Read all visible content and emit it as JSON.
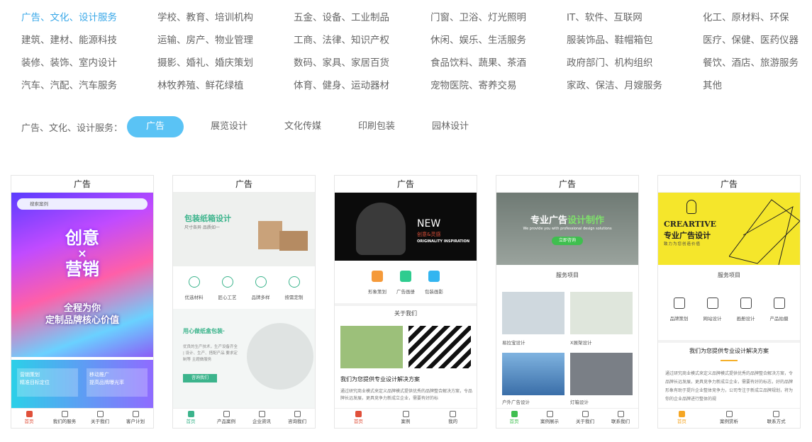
{
  "categories": [
    "广告、文化、设计服务",
    "学校、教育、培训机构",
    "五金、设备、工业制品",
    "门窗、卫浴、灯光照明",
    "IT、软件、互联网",
    "化工、原材料、环保",
    "建筑、建材、能源科技",
    "运输、房产、物业管理",
    "工商、法律、知识产权",
    "休闲、娱乐、生活服务",
    "服装饰品、鞋帽箱包",
    "医疗、保健、医药仪器",
    "装修、装饰、室内设计",
    "摄影、婚礼、婚庆策划",
    "数码、家具、家居百货",
    "食品饮料、蔬果、茶酒",
    "政府部门、机构组织",
    "餐饮、酒店、旅游服务",
    "汽车、汽配、汽车服务",
    "林牧养殖、鲜花绿植",
    "体育、健身、运动器材",
    "宠物医院、寄养交易",
    "家政、保洁、月嫂服务",
    "其他"
  ],
  "subbar": {
    "label": "广告、文化、设计服务：",
    "tabs": [
      "广告",
      "展览设计",
      "文化传媒",
      "印刷包装",
      "园林设计"
    ]
  },
  "colors": {
    "accent": "#3aa8e8",
    "pill": "#5ac3f5"
  },
  "cards": [
    {
      "title": "广告",
      "search": "搜索案例",
      "hero1": "创意",
      "hero_x": "×",
      "hero2": "营销",
      "hero3": "全程为你",
      "hero4": "定制品牌核心价值",
      "box1a": "营销策划",
      "box1b": "精准目标定位",
      "box2a": "移动推广",
      "box2b": "提高品牌曝光率",
      "tabs": [
        "首页",
        "我们的服务",
        "关于我们",
        "客户计划"
      ]
    },
    {
      "title": "广告",
      "hero": "包装纸箱设计",
      "hero_sub": "尺寸各异 品质如一",
      "icons": [
        "优选材料",
        "匠心工艺",
        "品牌多样",
        "按需定制"
      ],
      "promo": "用心做纸盒包装·",
      "promo_text": "优良的生产技术，生产设备齐全 | 设计、生产、搭配产品 要求定制等 主题做服务",
      "btn": "咨询我们",
      "tabs": [
        "首页",
        "产品案例",
        "企业资讯",
        "咨询我们"
      ]
    },
    {
      "title": "广告",
      "new": "NEW",
      "new_cn": "创意&灵感",
      "new_en": "ORIGINALITY INSPIRATION",
      "icons": [
        "形象策划",
        "广告画册",
        "包装画影"
      ],
      "sec": "关于我们",
      "headline": "我们为您提供专业设计解决方案",
      "text": "通过研究商业模式来定义品牌模式提供优秀的品牌整合解决方案，令品牌长远发展，更具竞争力新成立企业，需要有好的标",
      "tabs": [
        "首页",
        "案例",
        "我的"
      ]
    },
    {
      "title": "广告",
      "hero": "专业广告",
      "hero_hl": "设计制作",
      "hero_sub": "We provide you with professional design solutions",
      "btn": "立即咨询",
      "sec": "服务项目",
      "items": [
        "易拉宝设计",
        "X展架设计",
        "户外广告设计",
        "灯箱设计"
      ],
      "tabs": [
        "首页",
        "案例展示",
        "关于我们",
        "联系我们"
      ]
    },
    {
      "title": "广告",
      "brand": "CREARTIVE",
      "hero": "专业广告设计",
      "hero_sub": "致力为您创造价值",
      "sec": "服务项目",
      "icons": [
        "品牌策划",
        "网站设计",
        "画册设计",
        "产品拍摄"
      ],
      "headline": "我们为您提供专业设计解决方案",
      "text": "通过研究商业模式来定义品牌模式提供优秀的品牌整合解决方案，令品牌长远发展，更具竞争力新成立企业，需要有好的标志，好的品牌形象有助于提升企业整体竞争力，公司专注于新成立品牌规划，将为你的企业品牌进行整体的规",
      "tabs": [
        "首页",
        "案例赏析",
        "联系方式"
      ]
    }
  ]
}
